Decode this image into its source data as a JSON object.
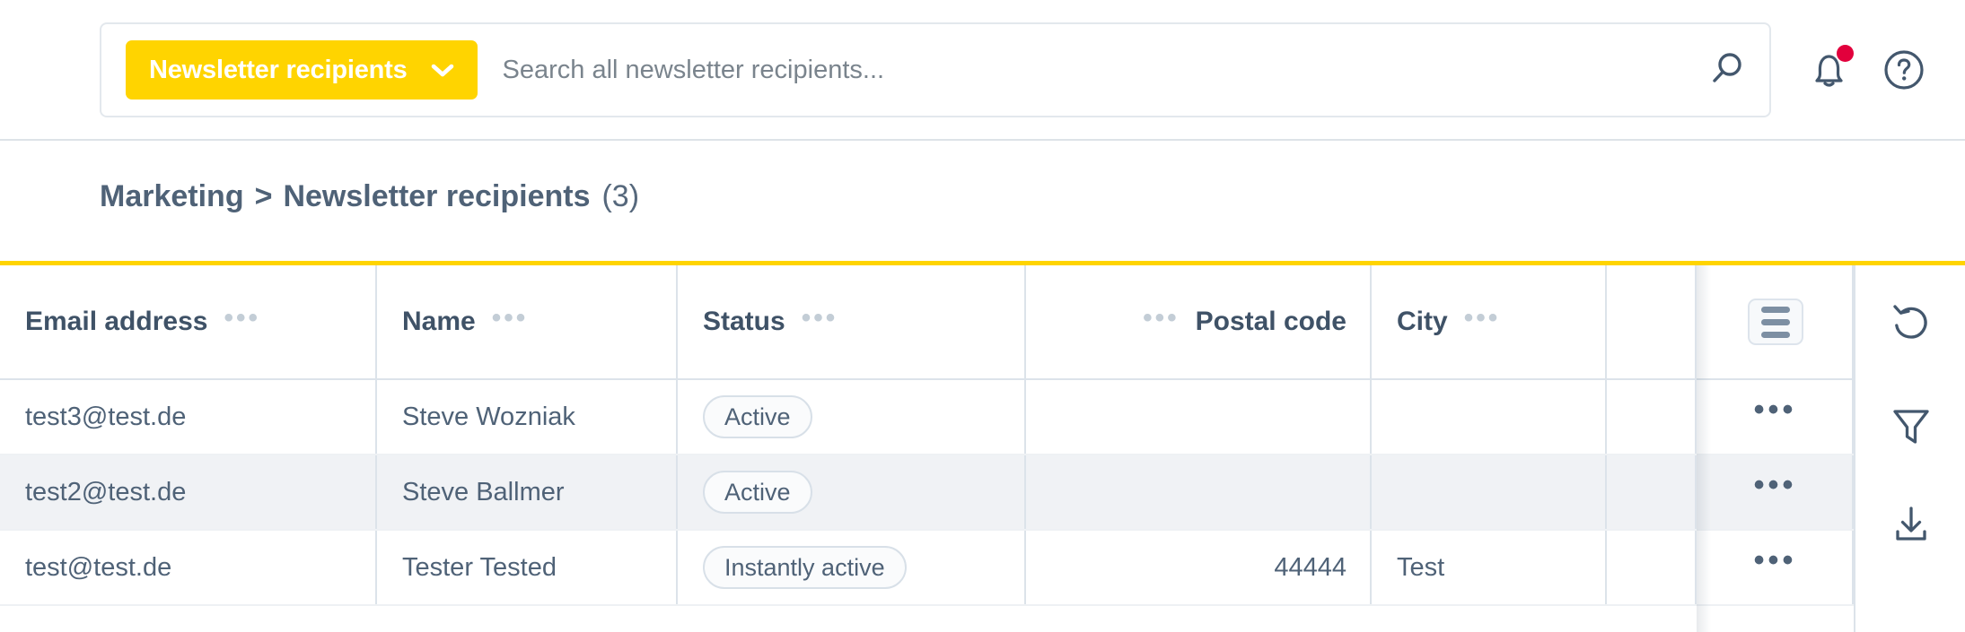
{
  "topbar": {
    "scope_button_label": "Newsletter recipients",
    "scope_chevron_icon": "chevron-down-icon",
    "search_placeholder": "Search all newsletter recipients...",
    "search_value": "",
    "search_icon": "search-icon",
    "notifications_icon": "bell-icon",
    "notifications_has_badge": true,
    "help_icon": "question-circle-icon"
  },
  "breadcrumb": {
    "parent": "Marketing",
    "separator": ">",
    "current": "Newsletter recipients",
    "count": "(3)"
  },
  "table": {
    "accent_color": "#FFD400",
    "columns": [
      {
        "key": "email",
        "label": "Email address",
        "menu_icon": "column-menu-icon",
        "align": "left"
      },
      {
        "key": "name",
        "label": "Name",
        "menu_icon": "column-menu-icon",
        "align": "left"
      },
      {
        "key": "status",
        "label": "Status",
        "menu_icon": "column-menu-icon",
        "align": "left"
      },
      {
        "key": "postal",
        "label": "Postal code",
        "menu_icon": "column-menu-icon",
        "align": "right"
      },
      {
        "key": "city",
        "label": "City",
        "menu_icon": "column-menu-icon",
        "align": "left"
      }
    ],
    "column_chooser_icon": "list-menu-icon",
    "rows": [
      {
        "email": "test3@test.de",
        "name": "Steve Wozniak",
        "status": "Active",
        "postal": "",
        "city": "",
        "actions": "•••",
        "highlighted": false
      },
      {
        "email": "test2@test.de",
        "name": "Steve Ballmer",
        "status": "Active",
        "postal": "",
        "city": "",
        "actions": "•••",
        "highlighted": true
      },
      {
        "email": "test@test.de",
        "name": "Tester Tested",
        "status": "Instantly active",
        "postal": "44444",
        "city": "Test",
        "actions": "•••",
        "highlighted": false
      }
    ],
    "header_dots": "•••"
  },
  "rail": {
    "undo_icon": "undo-arrow-icon",
    "filter_icon": "funnel-filter-icon",
    "download_icon": "download-icon"
  },
  "colors": {
    "accent_yellow": "#FFD400",
    "text_slate": "#4F6277",
    "border": "#DCE3EA",
    "row_highlight": "#F0F2F5",
    "notification_red": "#E2003C"
  }
}
